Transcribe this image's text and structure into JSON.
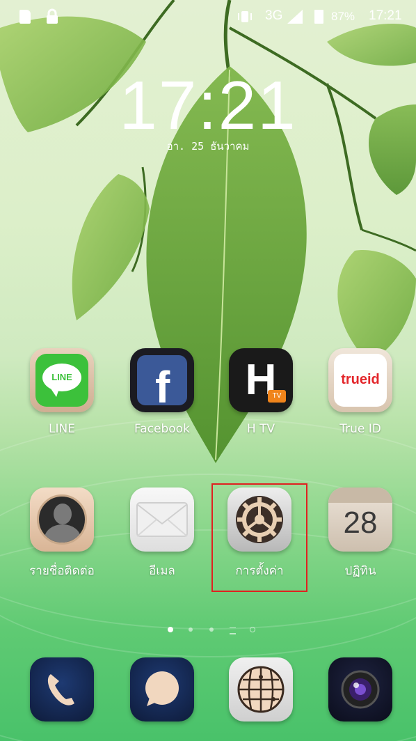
{
  "status_bar": {
    "network": "3G",
    "battery": "87%",
    "time": "17:21"
  },
  "lockscreen": {
    "clock": "17:21",
    "date": "อา. 25 ธันวาคม"
  },
  "apps_row1": [
    {
      "label": "LINE",
      "icon": "line-icon"
    },
    {
      "label": "Facebook",
      "icon": "facebook-icon"
    },
    {
      "label": "H TV",
      "icon": "htv-icon",
      "badge": "TV"
    },
    {
      "label": "True ID",
      "icon": "trueid-icon",
      "logo_text": "trueid"
    }
  ],
  "apps_row2": [
    {
      "label": "รายชื่อติดต่อ",
      "icon": "contacts-icon"
    },
    {
      "label": "อีเมล",
      "icon": "email-icon"
    },
    {
      "label": "การตั้งค่า",
      "icon": "settings-gear-icon"
    },
    {
      "label": "ปฏิทิน",
      "icon": "calendar-icon",
      "day": "28"
    }
  ],
  "dock": [
    {
      "icon": "phone-icon"
    },
    {
      "icon": "messages-icon"
    },
    {
      "icon": "browser-globe-icon"
    },
    {
      "icon": "camera-icon"
    }
  ],
  "colors": {
    "highlight": "#e02020",
    "line_green": "#3cc13b",
    "facebook_blue": "#3b5998",
    "htv_orange": "#f0841b",
    "trueid_red": "#e3262b"
  }
}
